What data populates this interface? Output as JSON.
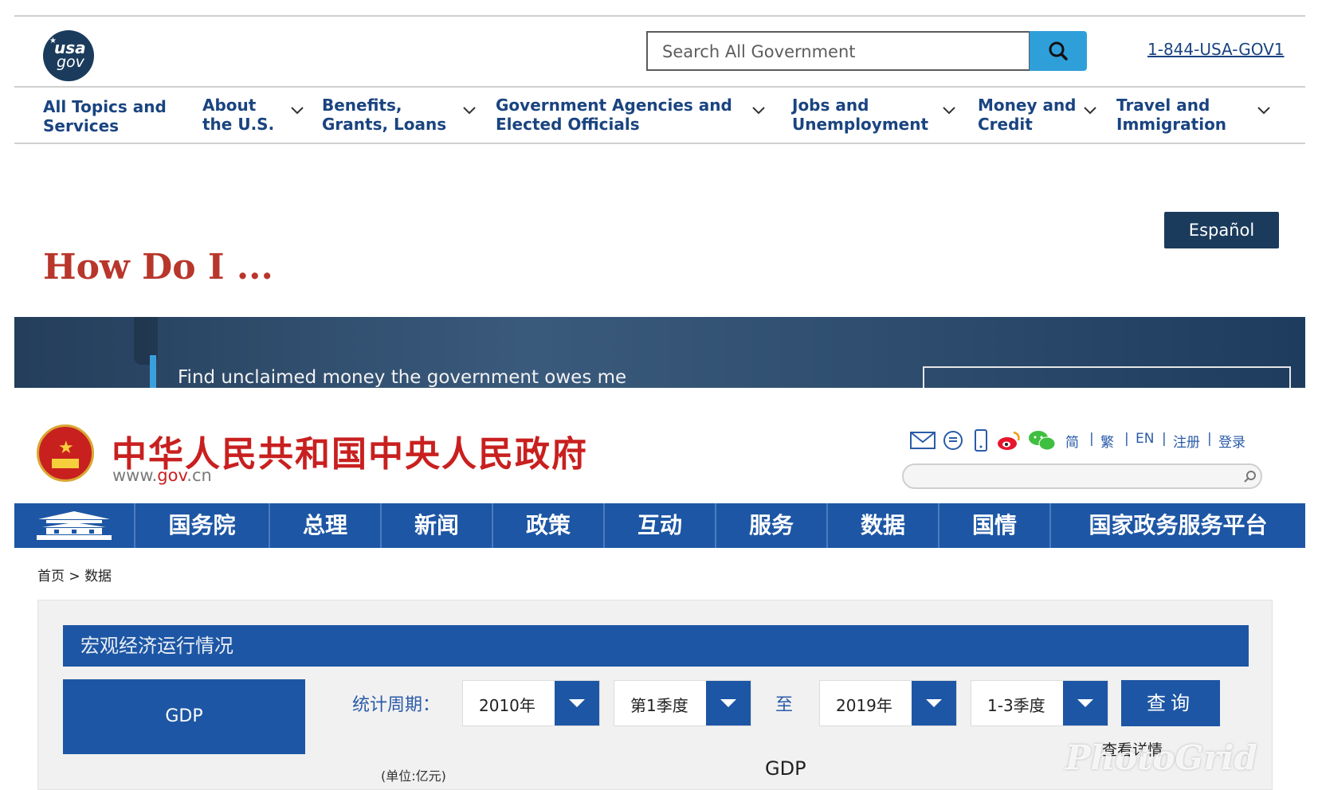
{
  "usagov": {
    "logo": {
      "line1": "usa",
      "line2": "gov"
    },
    "search": {
      "placeholder": "Search All Government"
    },
    "phone": "1-844-USA-GOV1",
    "nav": [
      {
        "line1": "All Topics and",
        "line2": "Services"
      },
      {
        "line1": "About",
        "line2": "the U.S."
      },
      {
        "line1": "Benefits,",
        "line2": "Grants, Loans"
      },
      {
        "line1": "Government Agencies and",
        "line2": "Elected Officials"
      },
      {
        "line1": "Jobs and",
        "line2": "Unemployment"
      },
      {
        "line1": "Money and",
        "line2": "Credit"
      },
      {
        "line1": "Travel and",
        "line2": "Immigration"
      }
    ],
    "heading": "How Do I ...",
    "language_button": "Español",
    "banner_text": "Find unclaimed money the government owes me"
  },
  "govcn": {
    "title": "中华人民共和国中央人民政府",
    "url": {
      "prefix": "www.",
      "domain": "gov",
      "suffix": ".cn"
    },
    "toolbar": [
      "简",
      "繁",
      "EN",
      "注册",
      "登录"
    ],
    "nav": [
      "国务院",
      "总理",
      "新闻",
      "政策",
      "互动",
      "服务",
      "数据",
      "国情",
      "国家政务服务平台"
    ],
    "breadcrumb": {
      "home": "首页",
      "sep": ">",
      "current": "数据"
    },
    "panel_title": "宏观经济运行情况",
    "indicator_button": "GDP",
    "period_label": "统计周期：",
    "start_year": "2010年",
    "start_quarter": "第1季度",
    "to_label": "至",
    "end_year": "2019年",
    "end_quarter": "1-3季度",
    "query_button": "查询",
    "detail_link": "查看详情",
    "unit_label": "(单位:亿元)",
    "chart_title": "GDP"
  },
  "watermark": "PhotoGrid",
  "colors": {
    "usa_navy": "#1a4480",
    "usa_red": "#b8362b",
    "cn_blue": "#1d56a4",
    "cn_red": "#c8201f",
    "search_blue": "#2f9fd9"
  }
}
